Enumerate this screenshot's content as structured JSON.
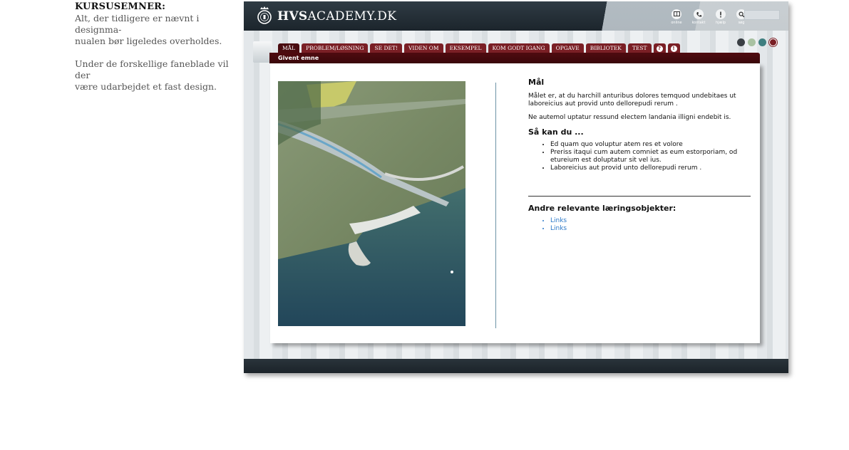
{
  "note": {
    "title": "KURSUSEMNER:",
    "lines1": [
      "Alt, der tidligere er nævnt i designma-",
      "nualen bør ligeledes overholdes."
    ],
    "lines2": [
      "Under de forskellige faneblade vil der",
      "være udarbejdet et fast design."
    ]
  },
  "header": {
    "brand_bold": "HVS",
    "brand_rest": "ACADEMY.DK",
    "icons": [
      {
        "name": "online-icon",
        "label": "online"
      },
      {
        "name": "kontakt-icon",
        "label": "kontakt"
      },
      {
        "name": "hjaelp-icon",
        "label": "hjælp"
      },
      {
        "name": "soeg-icon",
        "label": "søg"
      }
    ]
  },
  "tabs": [
    {
      "label": "MÅL",
      "active": true
    },
    {
      "label": "PROBLEM/LØSNING"
    },
    {
      "label": "SE DET!"
    },
    {
      "label": "VIDEN OM"
    },
    {
      "label": "EKSEMPEL"
    },
    {
      "label": "KOM GODT IGANG"
    },
    {
      "label": "OPGAVE"
    },
    {
      "label": "BIBLIOTEK"
    },
    {
      "label": "TEST"
    },
    {
      "label": "?"
    },
    {
      "label": "!"
    }
  ],
  "theme_colors": [
    "#3a3f44",
    "#a9c2a2",
    "#3f7f80",
    "#7a1f25"
  ],
  "subject": "Givent emne",
  "content": {
    "heading": "Mål",
    "para1": "Målet er, at du harchill anturibus dolores temquod undebitaes ut laboreicius aut provid unto dellorepudi rerum .",
    "para2": "Ne autemol uptatur ressund electem landania illigni endebit is.",
    "subheading": "Så kan du ...",
    "bullets": [
      "Ed quam quo voluptur atem res et volore",
      "Preriss itaqui cum autem comniet as eum estorporiam, od etureium est doluptatur sit vel ius.",
      "Laboreicius aut provid unto dellorepudi rerum ."
    ],
    "related_heading": "Andre relevante læringsobjekter:",
    "links": [
      "Links",
      "Links"
    ]
  }
}
